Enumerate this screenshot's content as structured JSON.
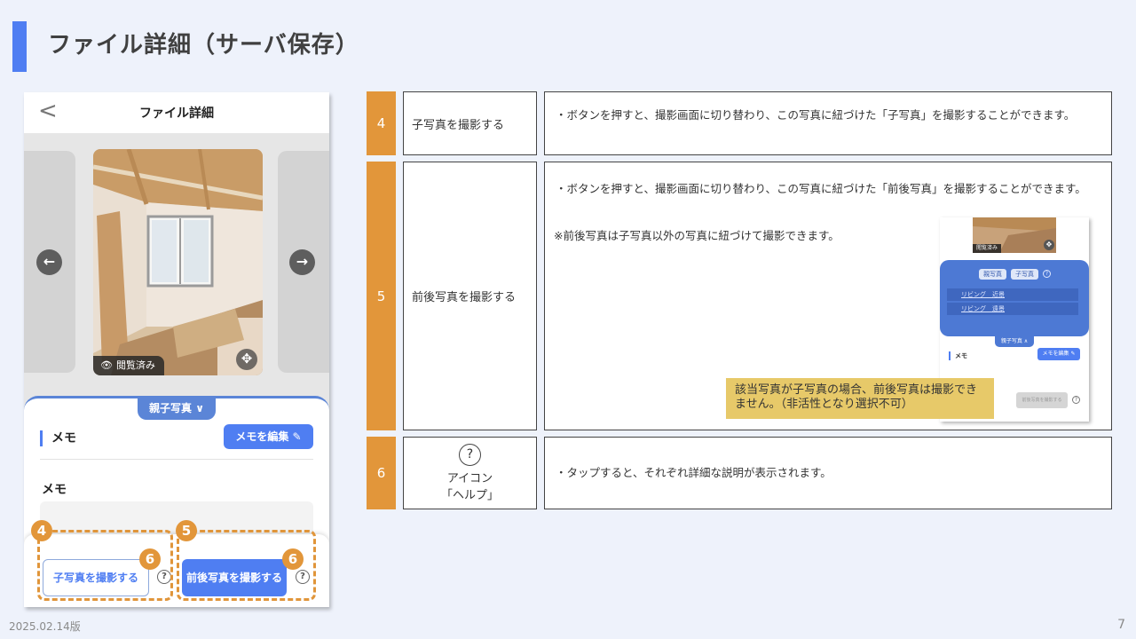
{
  "page": {
    "title": "ファイル詳細（サーバ保存）",
    "date": "2025.02.14版",
    "page_number": "7"
  },
  "phone": {
    "back": "<",
    "header_title": "ファイル詳細",
    "nav_prev": "←",
    "nav_next": "→",
    "seen_label": "閲覧済み",
    "tab_label": "親子写真 ∨",
    "memo_heading": "メモ",
    "memo_edit_button": "メモを編集 ✎",
    "memo_label": "メモ",
    "child_photo_button": "子写真を撮影する",
    "before_after_button": "前後写真を撮影する",
    "help": "?"
  },
  "markers": {
    "m4": "4",
    "m5": "5",
    "m6a": "6",
    "m6b": "6"
  },
  "rows": [
    {
      "num": "4",
      "name": "子写真を撮影する",
      "bullet": "・ボタンを押すと、撮影画面に切り替わり、この写真に紐づけた「子写真」を撮影することができます。"
    },
    {
      "num": "5",
      "name": "前後写真を撮影する",
      "bullet": "・ボタンを押すと、撮影画面に切り替わり、この写真に紐づけた「前後写真」を撮影することができます。",
      "note": "※前後写真は子写真以外の写真に紐づけて撮影できます。",
      "callout": "該当写真が子写真の場合、前後写真は撮影できません。（非活性となり選択不可）",
      "thumb": {
        "seen": "閲覧済み",
        "pill_parent": "親写真",
        "pill_child": "子写真",
        "row1": "リビング　近景",
        "row2": "リビング　遠景",
        "tab": "親子写真 ∧",
        "memo": "メモ",
        "edit": "メモを編集 ✎",
        "button": "前後写真を撮影する",
        "help": "?"
      }
    },
    {
      "num": "6",
      "name_line1": "アイコン",
      "name_line2": "「ヘルプ」",
      "help": "?",
      "bullet": "・タップすると、それぞれ詳細な説明が表示されます。"
    }
  ],
  "colors": {
    "accent": "#4f7ef2",
    "orange": "#e2963a",
    "callout": "#e7c969"
  }
}
